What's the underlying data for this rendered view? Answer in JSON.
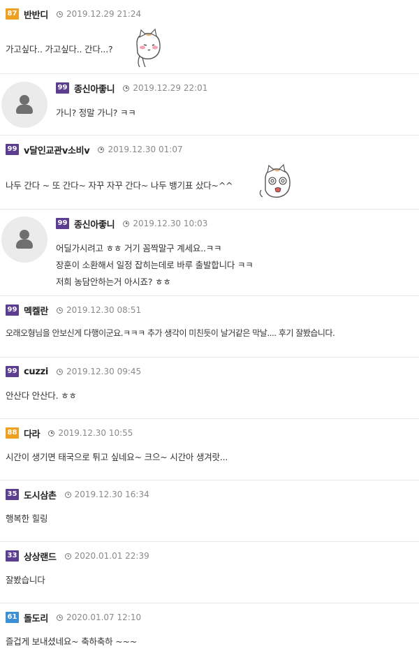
{
  "badge_colors": {
    "orange": "#f0a020",
    "purple": "#5b3e8f",
    "blue": "#3a8fd6"
  },
  "comments": [
    {
      "level": "87",
      "level_color": "#f0a020",
      "name": "반반디",
      "time": "2019.12.29 21:24",
      "lines": [
        "가고싶다.. 가고싶다.. 간다...?"
      ],
      "emoticon": "blushing-cat-emoticon"
    },
    {
      "level": "99",
      "level_color": "#5b3e8f",
      "name": "종신아좋니",
      "time": "2019.12.29 22:01",
      "lines": [
        "가니? 정말 가니? ㅋㅋ"
      ],
      "avatar": "default-avatar-icon"
    },
    {
      "level": "99",
      "level_color": "#5b3e8f",
      "name": "v달인교관v소비v",
      "time": "2019.12.30 01:07",
      "lines": [
        "나두 간다 ~ 또 간다~ 자꾸 자꾸 간다~ 나두 뱅기표 샀다~^^"
      ],
      "emoticon": "dizzy-cat-emoticon"
    },
    {
      "level": "99",
      "level_color": "#5b3e8f",
      "name": "종신아좋니",
      "time": "2019.12.30 10:03",
      "lines": [
        "어딜가시려고 ㅎㅎ 거기 꼼짝말구 계세요..ㅋㅋ",
        "장훈이 소환해서 일정 잡히는데로 바루 출발합니다 ㅋㅋ",
        "저희 농담안하는거 아시죠? ㅎㅎ"
      ],
      "avatar": "default-avatar-icon"
    },
    {
      "level": "99",
      "level_color": "#5b3e8f",
      "name": "멕켈란",
      "time": "2019.12.30 08:51",
      "lines": [
        "오래오형님을 안보신게 다행이군요.ㅋㅋㅋ 추가 생각이 미친듯이 날거같은 막날.... 후기 잘봤습니다."
      ]
    },
    {
      "level": "99",
      "level_color": "#5b3e8f",
      "name": "cuzzi",
      "time": "2019.12.30 09:45",
      "lines": [
        "안산다 안산다. ㅎㅎ"
      ]
    },
    {
      "level": "88",
      "level_color": "#f0a020",
      "name": "다라",
      "time": "2019.12.30 10:55",
      "lines": [
        "시간이 생기면 태국으로 튀고 싶네요~ 크으~ 시간아 생겨랏..."
      ]
    },
    {
      "level": "35",
      "level_color": "#5b3e8f",
      "name": "도시삼촌",
      "time": "2019.12.30 16:34",
      "lines": [
        "행복한 힐링"
      ]
    },
    {
      "level": "33",
      "level_color": "#5b3e8f",
      "name": "상상랜드",
      "time": "2020.01.01 22:39",
      "lines": [
        "잘봤습니다"
      ]
    },
    {
      "level": "61",
      "level_color": "#3a8fd6",
      "name": "돌도리",
      "time": "2020.01.07 12:10",
      "lines": [
        "즐겁게 보내셨네요~ 축하축하 ~~~"
      ]
    }
  ]
}
